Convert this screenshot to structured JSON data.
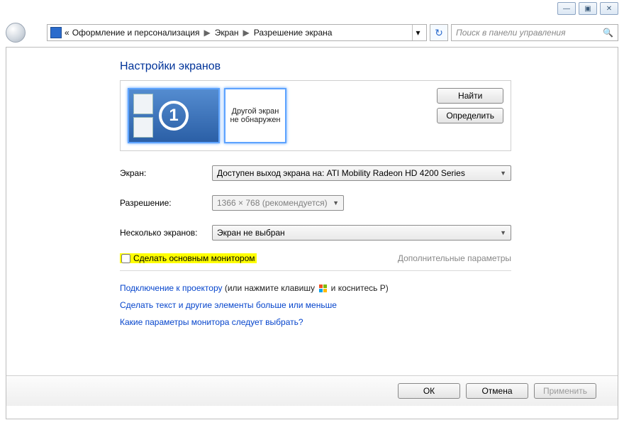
{
  "window_controls": {
    "min": "—",
    "max": "▣",
    "close": "✕"
  },
  "breadcrumb": {
    "prefix": "«",
    "part1": "Оформление и персонализация",
    "part2": "Экран",
    "part3": "Разрешение экрана"
  },
  "search": {
    "placeholder": "Поиск в панели управления"
  },
  "heading": "Настройки экранов",
  "preview": {
    "primary_number": "1",
    "other_text": "Другой экран не обнаружен"
  },
  "side_buttons": {
    "find": "Найти",
    "identify": "Определить"
  },
  "fields": {
    "screen_label": "Экран:",
    "screen_value": "Доступен выход экрана на: ATI Mobility Radeon HD 4200 Series",
    "resolution_label": "Разрешение:",
    "resolution_value": "1366 × 768 (рекомендуется)",
    "multiple_label": "Несколько экранов:",
    "multiple_value": "Экран не выбран"
  },
  "checkbox_label": "Сделать основным монитором",
  "advanced_link": "Дополнительные параметры",
  "links": {
    "projector_link": "Подключение к проектору",
    "projector_plain_a": " (или нажмите клавишу ",
    "projector_plain_b": " и коснитесь P)",
    "text_size": "Сделать текст и другие элементы больше или меньше",
    "which_settings": "Какие параметры монитора следует выбрать?"
  },
  "footer": {
    "ok": "ОК",
    "cancel": "Отмена",
    "apply": "Применить"
  }
}
